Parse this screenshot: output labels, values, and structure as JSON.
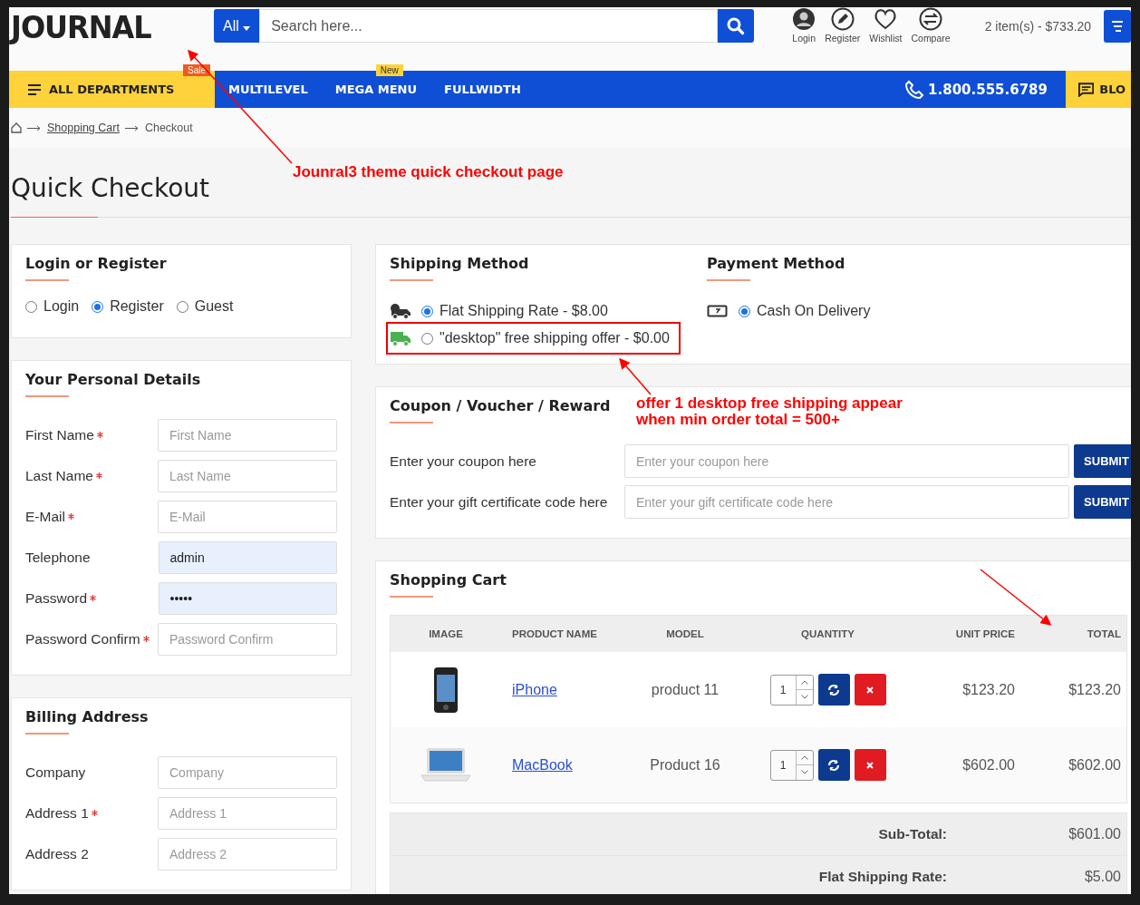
{
  "header": {
    "logo": "JOURNAL",
    "search": {
      "category": "All",
      "placeholder": "Search here..."
    },
    "account_links": [
      {
        "label": "Login",
        "kind": "user"
      },
      {
        "label": "Register",
        "kind": "pencil"
      },
      {
        "label": "Wishlist",
        "kind": "heart"
      },
      {
        "label": "Compare",
        "kind": "swap"
      }
    ],
    "cart_summary": "2 item(s) - $733.20"
  },
  "nav": {
    "departments": "ALL DEPARTMENTS",
    "departments_badge": "Sale",
    "items": [
      {
        "label": "MULTILEVEL"
      },
      {
        "label": "MEGA MENU",
        "badge": "New"
      },
      {
        "label": "FULLWIDTH"
      }
    ],
    "phone": "1.800.555.6789",
    "blog": "BLO"
  },
  "breadcrumb": [
    {
      "label": "Shopping Cart",
      "kind": "link"
    },
    {
      "label": "Checkout",
      "kind": "current"
    }
  ],
  "page_title": "Quick Checkout",
  "login_register": {
    "title": "Login or Register",
    "options": [
      {
        "label": "Login",
        "selected": false
      },
      {
        "label": "Register",
        "selected": true
      },
      {
        "label": "Guest",
        "selected": false
      }
    ]
  },
  "personal_details": {
    "title": "Your Personal Details",
    "fields": [
      {
        "label": "First Name",
        "required": true,
        "placeholder": "First Name"
      },
      {
        "label": "Last Name",
        "required": true,
        "placeholder": "Last Name"
      },
      {
        "label": "E-Mail",
        "required": true,
        "placeholder": "E-Mail"
      },
      {
        "label": "Telephone",
        "required": false,
        "value": "admin",
        "autofilled": true
      },
      {
        "label": "Password",
        "required": true,
        "value": "•••••",
        "autofilled": true
      },
      {
        "label": "Password Confirm",
        "required": true,
        "placeholder": "Password Confirm"
      }
    ]
  },
  "billing_address": {
    "title": "Billing Address",
    "fields": [
      {
        "label": "Company",
        "required": false,
        "placeholder": "Company"
      },
      {
        "label": "Address 1",
        "required": true,
        "placeholder": "Address 1"
      },
      {
        "label": "Address 2",
        "required": false,
        "placeholder": "Address 2"
      }
    ]
  },
  "shipping_method": {
    "title": "Shipping Method",
    "options": [
      {
        "label": "Flat Shipping Rate - $8.00",
        "selected": true,
        "kind": "flat",
        "annotated": false
      },
      {
        "label": "\"desktop\" free shipping offer - $0.00",
        "selected": false,
        "kind": "free",
        "annotated": true
      }
    ]
  },
  "payment_method": {
    "title": "Payment Method",
    "options": [
      {
        "label": "Cash On Delivery",
        "selected": true
      }
    ]
  },
  "coupon": {
    "title": "Coupon / Voucher / Reward",
    "rows": [
      {
        "label": "Enter your coupon here",
        "placeholder": "Enter your coupon here",
        "button": "SUBMIT"
      },
      {
        "label": "Enter your gift certificate code here",
        "placeholder": "Enter your gift certificate code here",
        "button": "SUBMIT"
      }
    ]
  },
  "shopping_cart": {
    "title": "Shopping Cart",
    "columns": [
      "IMAGE",
      "PRODUCT NAME",
      "MODEL",
      "QUANTITY",
      "UNIT PRICE",
      "TOTAL"
    ],
    "rows": [
      {
        "kind": "phone",
        "product": "iPhone",
        "model": "product 11",
        "quantity": "1",
        "unit_price": "$123.20",
        "total": "$123.20"
      },
      {
        "kind": "laptop",
        "product": "MacBook",
        "model": "Product 16",
        "quantity": "1",
        "unit_price": "$602.00",
        "total": "$602.00"
      }
    ],
    "totals": [
      {
        "label": "Sub-Total:",
        "value": "$601.00"
      },
      {
        "label": "Flat Shipping Rate:",
        "value": "$5.00"
      }
    ]
  },
  "annotations": [
    {
      "lines": [
        "Jounral3 theme quick checkout page"
      ]
    },
    {
      "lines": [
        "offer 1 desktop free shipping appear",
        "when min order total = 500+"
      ]
    }
  ]
}
